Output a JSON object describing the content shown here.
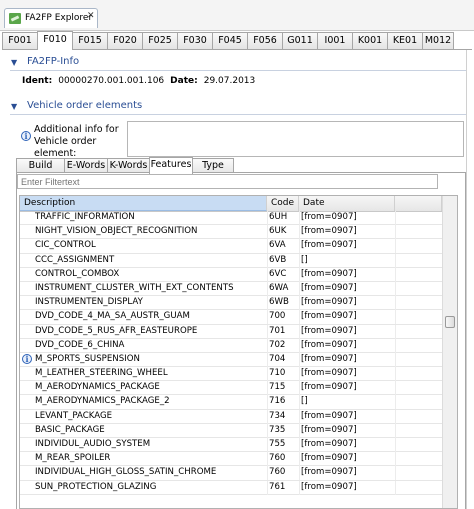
{
  "window": {
    "title": "FA2FP Explorer",
    "close_glyph": "✕"
  },
  "outer_tabs": [
    {
      "label": "F001"
    },
    {
      "label": "F010",
      "active": true
    },
    {
      "label": "F015"
    },
    {
      "label": "F020"
    },
    {
      "label": "F025"
    },
    {
      "label": "F030"
    },
    {
      "label": "F045"
    },
    {
      "label": "F056"
    },
    {
      "label": "G011"
    },
    {
      "label": "I001"
    },
    {
      "label": "K001"
    },
    {
      "label": "KE01"
    },
    {
      "label": "M012"
    }
  ],
  "fa2fp_info": {
    "header": "FA2FP-Info",
    "ident_label": "Ident:",
    "ident_value": "00000270.001.001.106",
    "date_label": "Date:",
    "date_value": "29.07.2013"
  },
  "vehicle_order": {
    "header": "Vehicle order elements",
    "additional_info_label": "Additional info for Vehicle order element:",
    "additional_info_value": ""
  },
  "inner_tabs": [
    {
      "label": "Build level"
    },
    {
      "label": "E-Words"
    },
    {
      "label": "K-Words"
    },
    {
      "label": "Features",
      "active": true
    },
    {
      "label": "Type key"
    }
  ],
  "filter": {
    "placeholder": "Enter Filtertext"
  },
  "table": {
    "columns": [
      "Description",
      "Code",
      "Date"
    ],
    "rows": [
      {
        "description": "TRAFFIC_INFORMATION",
        "code": "6UH",
        "date": "[from=0907]"
      },
      {
        "description": "NIGHT_VISION_OBJECT_RECOGNITION",
        "code": "6UK",
        "date": "[from=0907]"
      },
      {
        "description": "CIC_CONTROL",
        "code": "6VA",
        "date": "[from=0907]"
      },
      {
        "description": "CCC_ASSIGNMENT",
        "code": "6VB",
        "date": "[]"
      },
      {
        "description": "CONTROL_COMBOX",
        "code": "6VC",
        "date": "[from=0907]"
      },
      {
        "description": "INSTRUMENT_CLUSTER_WITH_EXT_CONTENTS",
        "code": "6WA",
        "date": "[from=0907]"
      },
      {
        "description": "INSTRUMENTEN_DISPLAY",
        "code": "6WB",
        "date": "[from=0907]"
      },
      {
        "description": "DVD_CODE_4_MA_SA_AUSTR_GUAM",
        "code": "700",
        "date": "[from=0907]"
      },
      {
        "description": "DVD_CODE_5_RUS_AFR_EASTEUROPE",
        "code": "701",
        "date": "[from=0907]"
      },
      {
        "description": "DVD_CODE_6_CHINA",
        "code": "702",
        "date": "[from=0907]"
      },
      {
        "description": "M_SPORTS_SUSPENSION",
        "code": "704",
        "date": "[from=0907]",
        "info": true
      },
      {
        "description": "M_LEATHER_STEERING_WHEEL",
        "code": "710",
        "date": "[from=0907]"
      },
      {
        "description": "M_AERODYNAMICS_PACKAGE",
        "code": "715",
        "date": "[from=0907]"
      },
      {
        "description": "M_AERODYNAMICS_PACKAGE_2",
        "code": "716",
        "date": "[]"
      },
      {
        "description": "LEVANT_PACKAGE",
        "code": "734",
        "date": "[from=0907]"
      },
      {
        "description": "BASIC_PACKAGE",
        "code": "735",
        "date": "[from=0907]"
      },
      {
        "description": "INDIVIDUL_AUDIO_SYSTEM",
        "code": "755",
        "date": "[from=0907]"
      },
      {
        "description": "M_REAR_SPOILER",
        "code": "760",
        "date": "[from=0907]"
      },
      {
        "description": "INDIVIDUAL_HIGH_GLOSS_SATIN_CHROME",
        "code": "760",
        "date": "[from=0907]"
      },
      {
        "description": "SUN_PROTECTION_GLAZING",
        "code": "761",
        "date": "[from=0907]"
      }
    ]
  }
}
